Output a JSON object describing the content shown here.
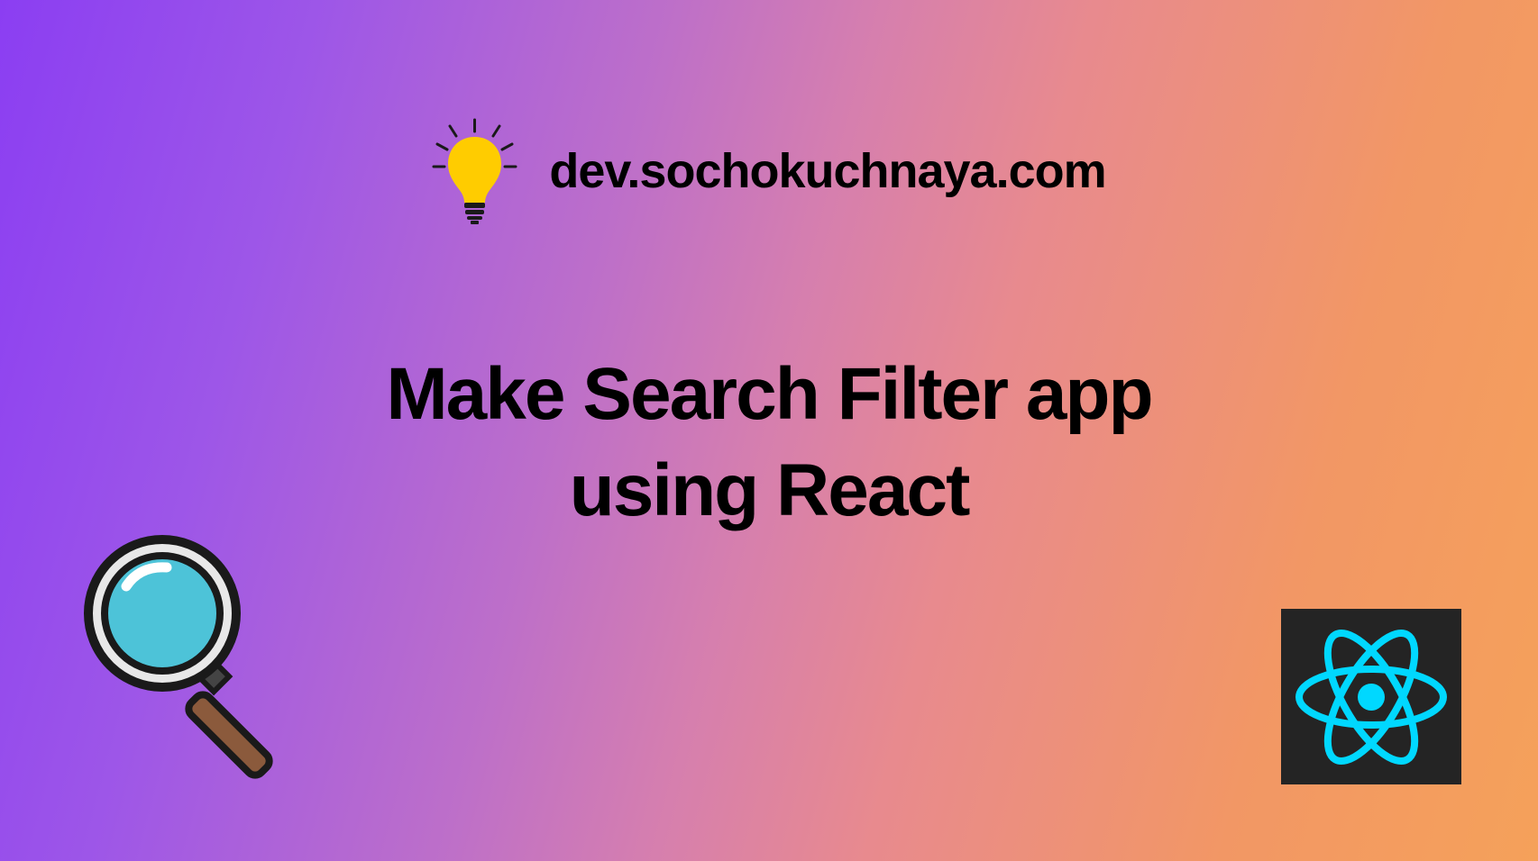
{
  "site_name": "dev.sochokuchnaya.com",
  "title_line1": "Make Search Filter app",
  "title_line2": "using React",
  "icons": {
    "bulb": "lightbulb-icon",
    "search": "magnifying-glass-icon",
    "react": "react-logo-icon"
  },
  "colors": {
    "bulb_fill": "#FFCC00",
    "glass_fill": "#4DC3D8",
    "react_cyan": "#00d8ff",
    "react_bg": "#242424"
  }
}
